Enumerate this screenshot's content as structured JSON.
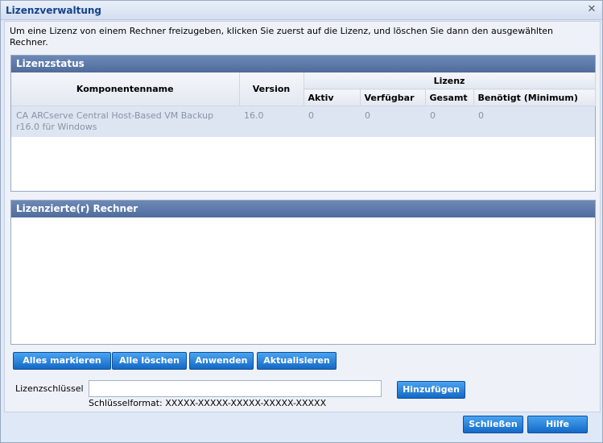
{
  "dialog": {
    "title": "Lizenzverwaltung",
    "close_glyph": "✕",
    "instructions": "Um eine Lizenz von einem Rechner freizugeben, klicken Sie zuerst auf die Lizenz, und löschen Sie dann den ausgewählten Rechner."
  },
  "license_status": {
    "header": "Lizenzstatus",
    "columns": {
      "component": "Komponentenname",
      "version": "Version",
      "license_group": "Lizenz",
      "active": "Aktiv",
      "available": "Verfügbar",
      "total": "Gesamt",
      "needed": "Benötigt (Minimum)"
    },
    "rows": [
      {
        "component": "CA ARCserve Central Host-Based VM Backup r16.0 für Windows",
        "version": "16.0",
        "active": "0",
        "available": "0",
        "total": "0",
        "needed": "0"
      }
    ]
  },
  "licensed_machines": {
    "header": "Lizenzierte(r) Rechner"
  },
  "actions": {
    "select_all": "Alles markieren",
    "delete_all": "Alle löschen",
    "apply": "Anwenden",
    "refresh": "Aktualisieren"
  },
  "license_key": {
    "label": "Lizenzschlüssel",
    "value": "",
    "format": "Schlüsselformat: XXXXX-XXXXX-XXXXX-XXXXX-XXXXX",
    "add_button": "Hinzufügen"
  },
  "footer": {
    "close_button": "Schließen",
    "help_button": "Hilfe"
  }
}
